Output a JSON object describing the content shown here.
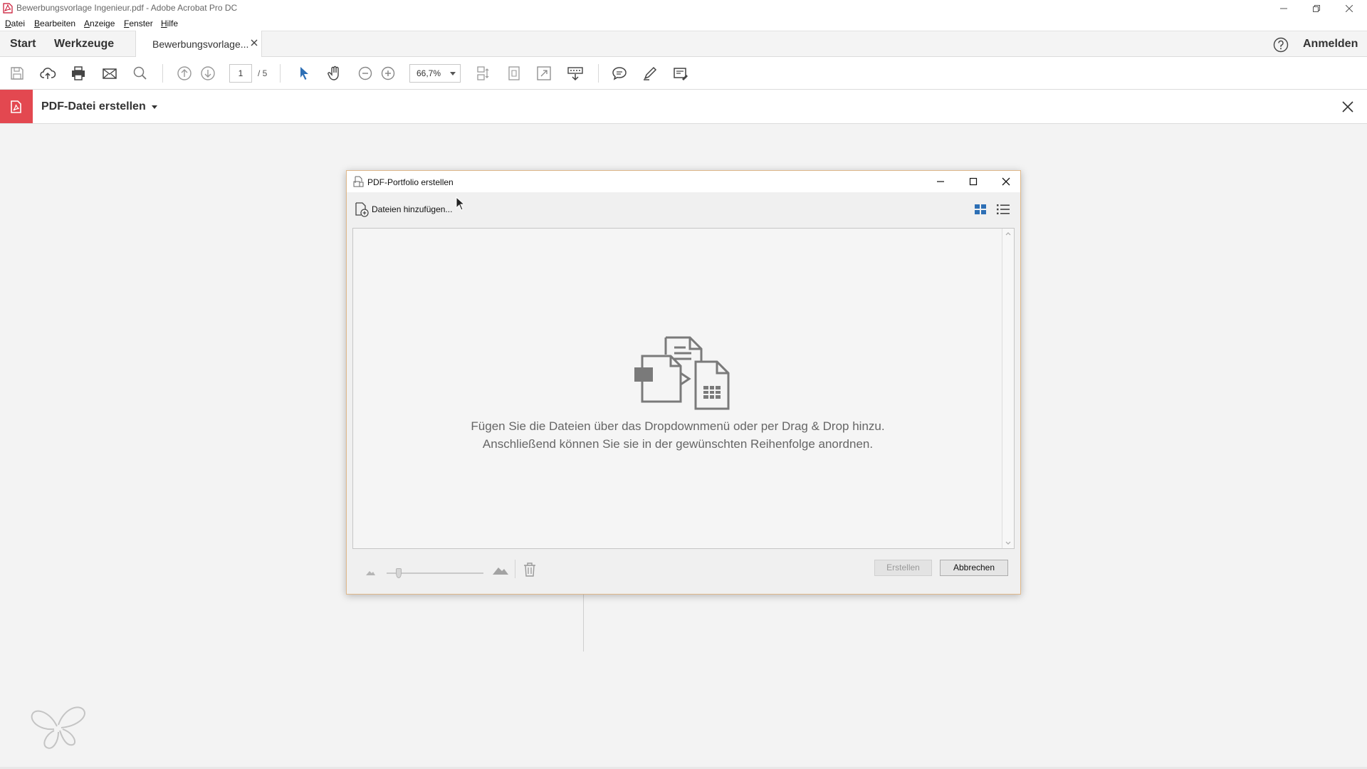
{
  "window": {
    "title": "Bewerbungsvorlage Ingenieur.pdf - Adobe Acrobat Pro DC"
  },
  "menu": {
    "items": [
      {
        "first": "D",
        "rest": "atei"
      },
      {
        "first": "B",
        "rest": "earbeiten"
      },
      {
        "first": "A",
        "rest": "nzeige"
      },
      {
        "first": "F",
        "rest": "enster"
      },
      {
        "first": "H",
        "rest": "ilfe"
      }
    ]
  },
  "tabs": {
    "start": "Start",
    "tools": "Werkzeuge",
    "document": "Bewerbungsvorlage...",
    "signin": "Anmelden"
  },
  "toolbar": {
    "page_current": "1",
    "page_total": "/ 5",
    "zoom": "66,7%"
  },
  "tool_header": {
    "label": "PDF-Datei erstellen"
  },
  "dialog": {
    "title": "PDF-Portfolio erstellen",
    "add_files": "Dateien hinzufügen...",
    "hint_line1": "Fügen Sie die Dateien über das Dropdownmenü oder per Drag & Drop hinzu.",
    "hint_line2": "Anschließend können Sie sie in der gewünschten Reihenfolge anordnen.",
    "create_button": "Erstellen",
    "cancel_button": "Abbrechen",
    "thumbnail_size": 0.1
  },
  "colors": {
    "accent_red": "#e34850",
    "view_blue": "#2d6fb5",
    "dialog_border": "#e0b88a"
  }
}
